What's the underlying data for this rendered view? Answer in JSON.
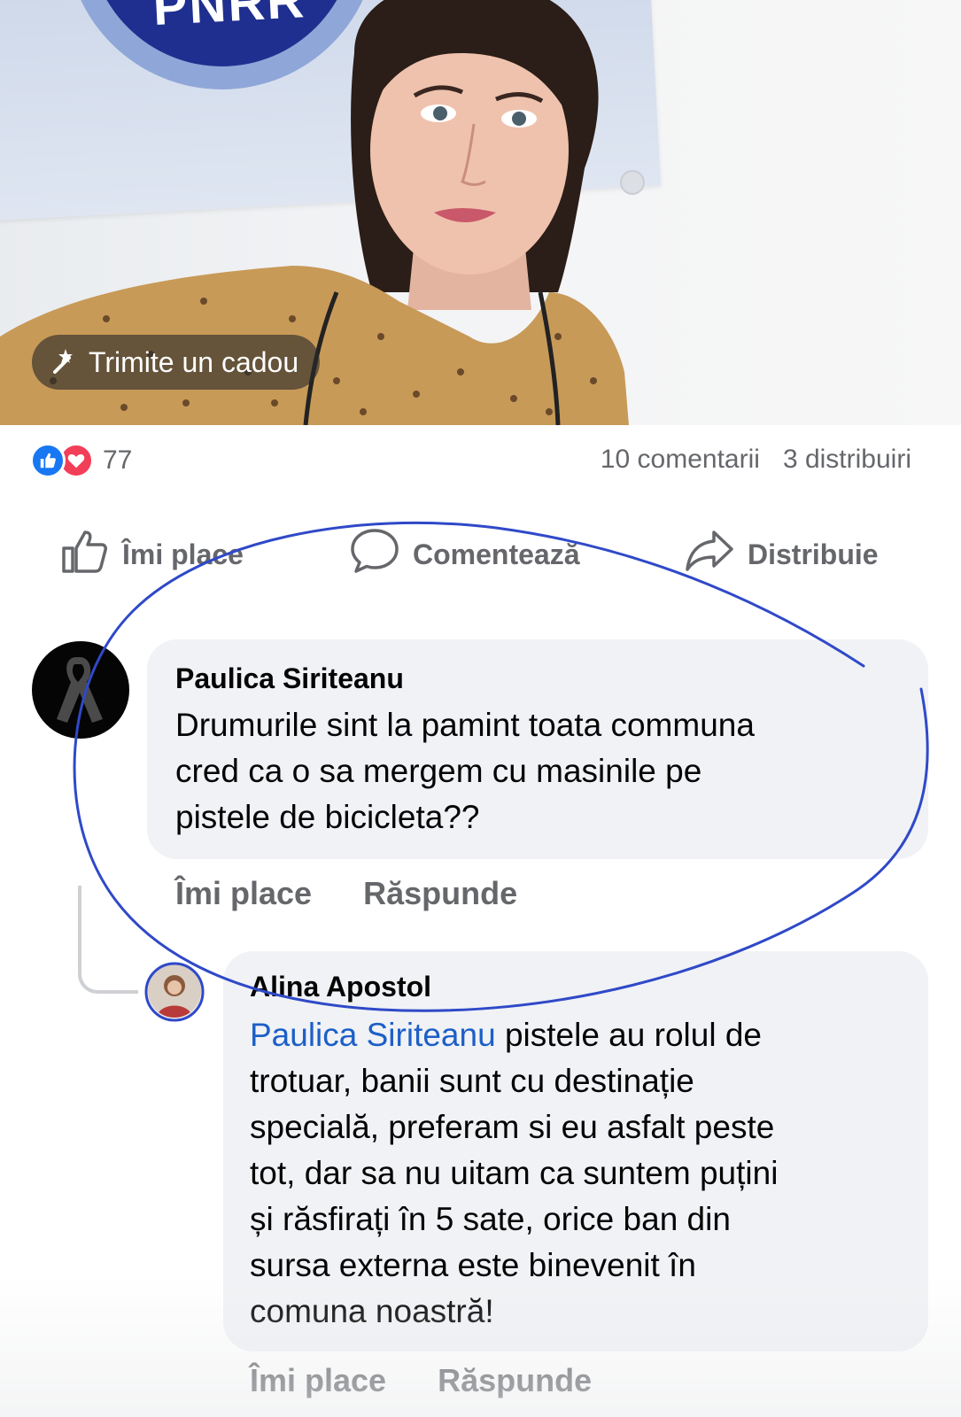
{
  "photo": {
    "banner_text": "PNRR",
    "gift_button": {
      "icon": "gift-icon",
      "label": "Trimite un cadou"
    }
  },
  "stats": {
    "reaction_icons": [
      "like-icon",
      "love-icon"
    ],
    "reaction_count": "77",
    "comments": "10 comentarii",
    "shares": "3 distribuiri"
  },
  "actions": {
    "like": {
      "icon": "thumbs-up-icon",
      "label": "Îmi place"
    },
    "comment": {
      "icon": "comment-bubble-icon",
      "label": "Comentează"
    },
    "share": {
      "icon": "share-arrow-icon",
      "label": "Distribuie"
    }
  },
  "comments": [
    {
      "author": "Paulica Siriteanu",
      "lines": [
        "Drumurile sint la pamint toata communa",
        "cred ca o sa mergem cu masinile pe",
        "pistele de bicicleta??"
      ],
      "like_label": "Îmi place",
      "reply_label": "Răspunde"
    },
    {
      "author": "Alina Apostol",
      "mention": "Paulica Siriteanu",
      "first_line_rest": " pistele au rolul de",
      "lines": [
        "trotuar, banii sunt cu destinație",
        "specială, preferam si eu asfalt peste",
        "tot, dar sa nu uitam ca suntem puțini",
        "și răsfirați în 5 sate, orice ban din",
        "sursa externa este binevenit în",
        "comuna noastră!"
      ],
      "like_label": "Îmi place",
      "reply_label": "Răspunde"
    }
  ],
  "colors": {
    "accent_blue": "#1877f2",
    "love_red": "#f33e58",
    "secondary_text": "#65676b",
    "bubble_bg": "#f0f2f5",
    "annotation_stroke": "#2f49c8"
  }
}
